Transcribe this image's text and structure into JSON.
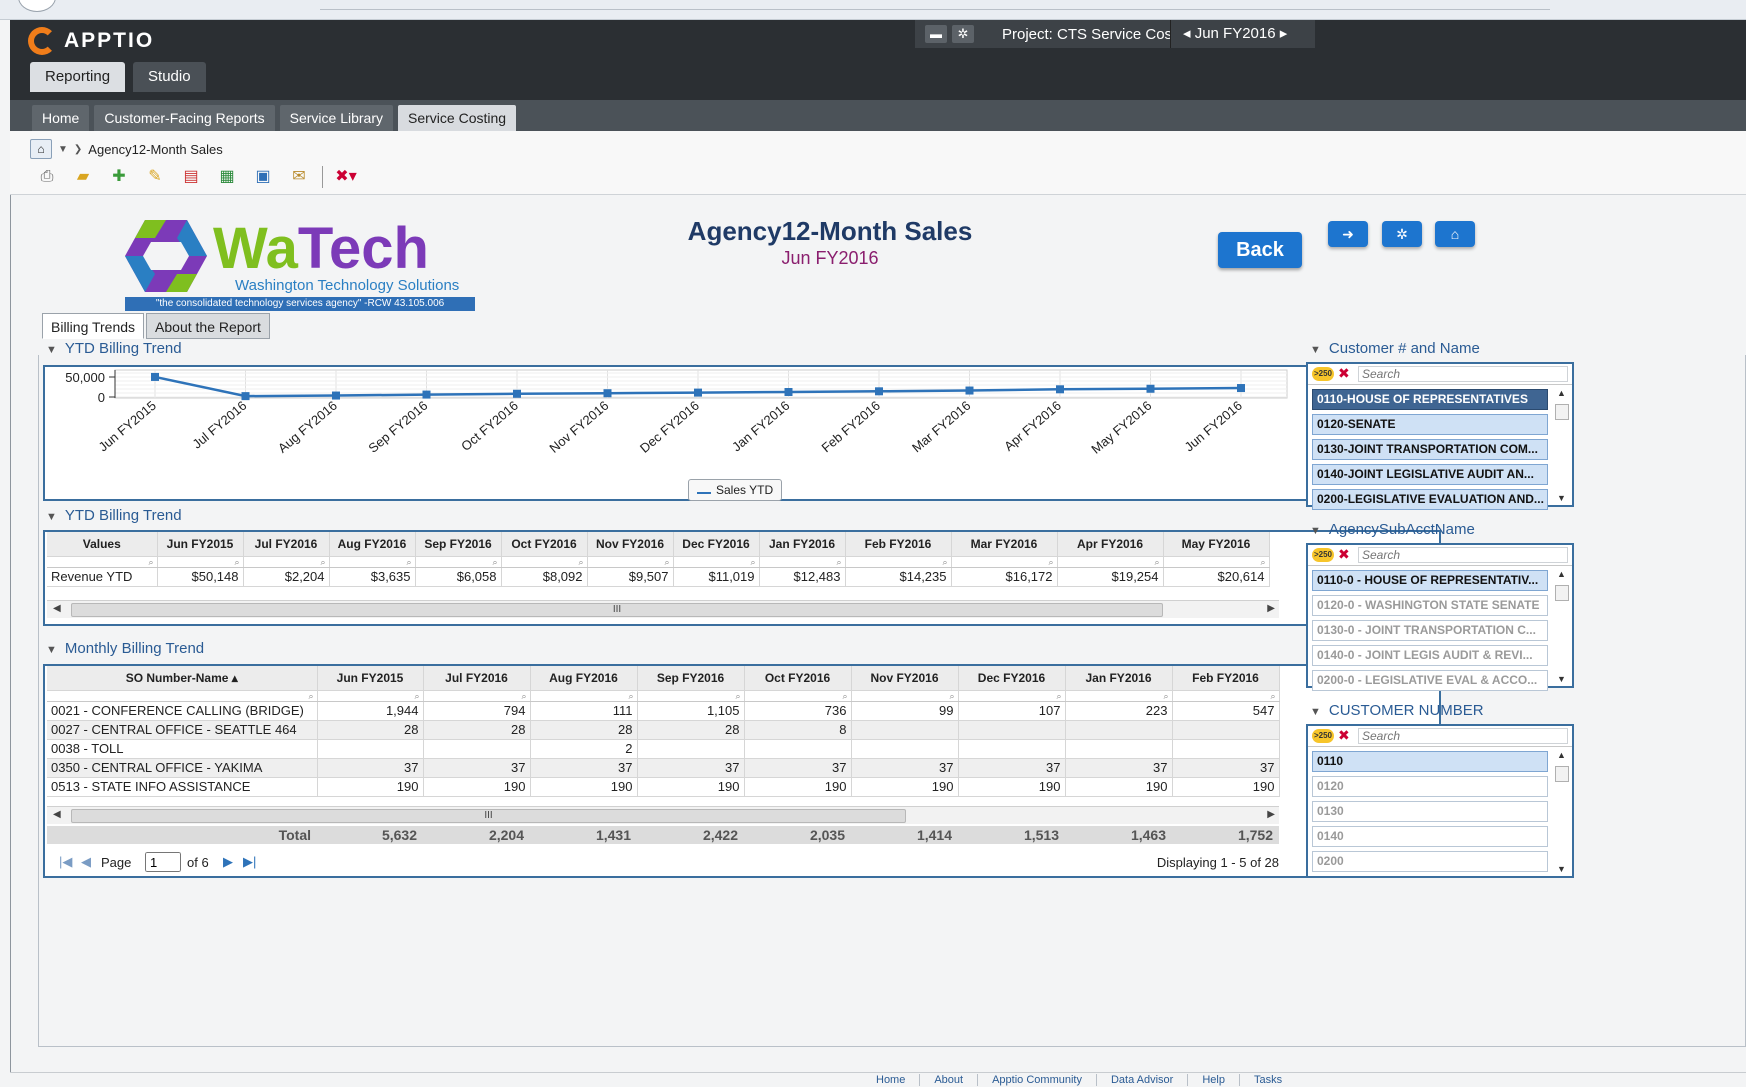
{
  "app": {
    "logo_text": "APPTIO",
    "main_tabs": [
      "Reporting",
      "Studio"
    ],
    "project_label": "Project: CTS Service Costing ▼",
    "period_label": "◂ Jun FY2016 ▸"
  },
  "sub_nav": [
    "Home",
    "Customer-Facing Reports",
    "Service Library",
    "Service Costing"
  ],
  "breadcrumb": {
    "current": "Agency12-Month Sales"
  },
  "logo": {
    "name_wa": "Wa",
    "name_tech": "Tech",
    "subtitle": "Washington Technology Solutions",
    "tagline": "\"the consolidated technology services agency\" -RCW 43.105.006"
  },
  "report": {
    "title": "Agency12-Month Sales",
    "subtitle": "Jun FY2016",
    "back_label": "Back",
    "tabs": [
      "Billing Trends",
      "About the Report"
    ]
  },
  "sections": {
    "chart_title": "YTD Billing Trend",
    "ytd_table_title": "YTD Billing Trend",
    "monthly_title": "Monthly Billing Trend"
  },
  "chart_data": {
    "type": "line",
    "categories": [
      "Jun FY2015",
      "Jul FY2016",
      "Aug FY2016",
      "Sep FY2016",
      "Oct FY2016",
      "Nov FY2016",
      "Dec FY2016",
      "Jan FY2016",
      "Feb FY2016",
      "Mar FY2016",
      "Apr FY2016",
      "May FY2016",
      "Jun FY2016"
    ],
    "series": [
      {
        "name": "Sales YTD",
        "values": [
          50148,
          2204,
          3635,
          6058,
          8092,
          9507,
          11019,
          12483,
          14235,
          16172,
          19254,
          20614,
          22400
        ]
      }
    ],
    "yticks": [
      "50,000",
      "0"
    ],
    "ylim": [
      0,
      55000
    ],
    "color": "#2e73b9",
    "grid": true,
    "legend": "bottom"
  },
  "ytd_table": {
    "headers": [
      "Values",
      "Jun FY2015",
      "Jul FY2016",
      "Aug FY2016",
      "Sep FY2016",
      "Oct FY2016",
      "Nov FY2016",
      "Dec FY2016",
      "Jan FY2016",
      "Feb FY2016",
      "Mar FY2016",
      "Apr FY2016",
      "May FY2016"
    ],
    "row": [
      "Revenue YTD",
      "$50,148",
      "$2,204",
      "$3,635",
      "$6,058",
      "$8,092",
      "$9,507",
      "$11,019",
      "$12,483",
      "$14,235",
      "$16,172",
      "$19,254",
      "$20,614"
    ]
  },
  "monthly_table": {
    "headers": [
      "SO Number-Name ▴",
      "Jun FY2015",
      "Jul FY2016",
      "Aug FY2016",
      "Sep FY2016",
      "Oct FY2016",
      "Nov FY2016",
      "Dec FY2016",
      "Jan FY2016",
      "Feb FY2016"
    ],
    "rows": [
      [
        "0021 - CONFERENCE CALLING (BRIDGE)",
        "1,944",
        "794",
        "111",
        "1,105",
        "736",
        "99",
        "107",
        "223",
        "547"
      ],
      [
        "0027 - CENTRAL OFFICE - SEATTLE 464",
        "28",
        "28",
        "28",
        "28",
        "8",
        "",
        "",
        "",
        ""
      ],
      [
        "0038 - TOLL",
        "",
        "",
        "2",
        "",
        "",
        "",
        "",
        "",
        ""
      ],
      [
        "0350 - CENTRAL OFFICE - YAKIMA",
        "37",
        "37",
        "37",
        "37",
        "37",
        "37",
        "37",
        "37",
        "37"
      ],
      [
        "0513 - STATE INFO ASSISTANCE",
        "190",
        "190",
        "190",
        "190",
        "190",
        "190",
        "190",
        "190",
        "190"
      ]
    ],
    "total_label": "Total",
    "totals": [
      "5,632",
      "2,204",
      "1,431",
      "2,422",
      "2,035",
      "1,414",
      "1,513",
      "1,463",
      "1,752"
    ],
    "pager": {
      "page_label": "Page",
      "page_value": "1",
      "of_label": "of 6",
      "displaying": "Displaying 1 - 5 of 28"
    }
  },
  "filters": {
    "customer": {
      "title": "Customer # and Name",
      "placeholder": "Search",
      "items": [
        "0110-HOUSE OF REPRESENTATIVES",
        "0120-SENATE",
        "0130-JOINT TRANSPORTATION COM...",
        "0140-JOINT LEGISLATIVE AUDIT AN...",
        "0200-LEGISLATIVE EVALUATION AND..."
      ]
    },
    "subacct": {
      "title": "AgencySubAcctName",
      "placeholder": "Search",
      "items": [
        "0110-0 - HOUSE OF REPRESENTATIV...",
        "0120-0 - WASHINGTON STATE SENATE",
        "0130-0 - JOINT TRANSPORTATION C...",
        "0140-0 - JOINT LEGIS AUDIT & REVI...",
        "0200-0 - LEGISLATIVE EVAL & ACCO..."
      ]
    },
    "custnum": {
      "title": "CUSTOMER NUMBER",
      "placeholder": "Search",
      "items": [
        "0110",
        "0120",
        "0130",
        "0140",
        "0200"
      ]
    },
    "badge": ">250"
  },
  "footer": [
    "Home",
    "About",
    "Apptio Community",
    "Data Advisor",
    "Help",
    "Tasks"
  ]
}
